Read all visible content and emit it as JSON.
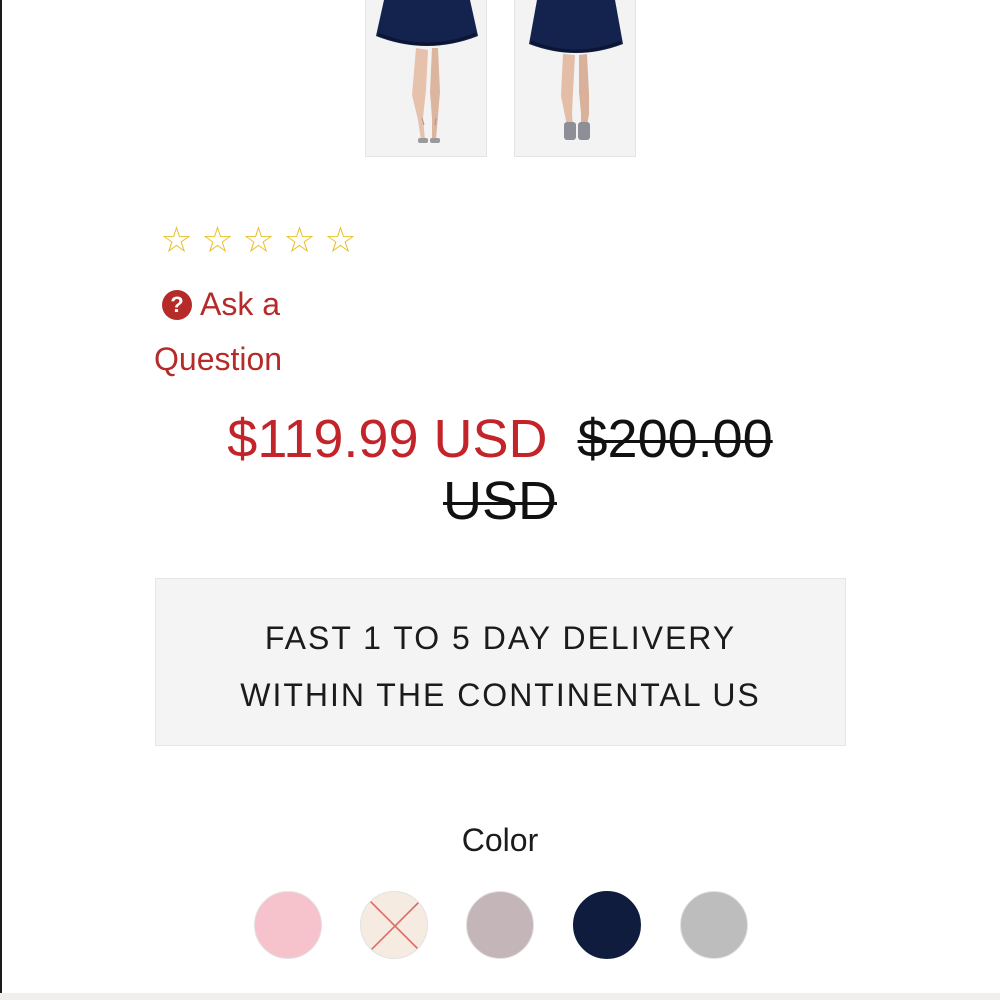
{
  "gallery": {
    "thumbnails": [
      {
        "name": "product-thumbnail-1",
        "alt": "navy dress front"
      },
      {
        "name": "product-thumbnail-2",
        "alt": "navy dress back"
      }
    ]
  },
  "rating": {
    "stars": [
      "☆",
      "☆",
      "☆",
      "☆",
      "☆"
    ],
    "value": 0,
    "max": 5
  },
  "ask_question": {
    "icon": "?",
    "line1": "Ask a",
    "line2": "Question"
  },
  "price": {
    "sale": "$119.99 USD",
    "original": "$200.00 USD"
  },
  "delivery": {
    "line1": "FAST 1 TO 5 DAY DELIVERY",
    "line2": "WITHIN THE CONTINENTAL US"
  },
  "color": {
    "label": "Color",
    "swatches": [
      {
        "name": "pink",
        "hex": "#f6c3cd",
        "available": true
      },
      {
        "name": "cream",
        "hex": "#f5ebe1",
        "available": false
      },
      {
        "name": "mauve",
        "hex": "#c4b5b9",
        "available": true
      },
      {
        "name": "navy",
        "hex": "#0f1c3d",
        "available": true
      },
      {
        "name": "gray",
        "hex": "#bdbdbd",
        "available": true
      }
    ]
  },
  "theme": {
    "accent": "#c3242a",
    "star": "#e8c12a",
    "navy": "#0f1c3d"
  }
}
